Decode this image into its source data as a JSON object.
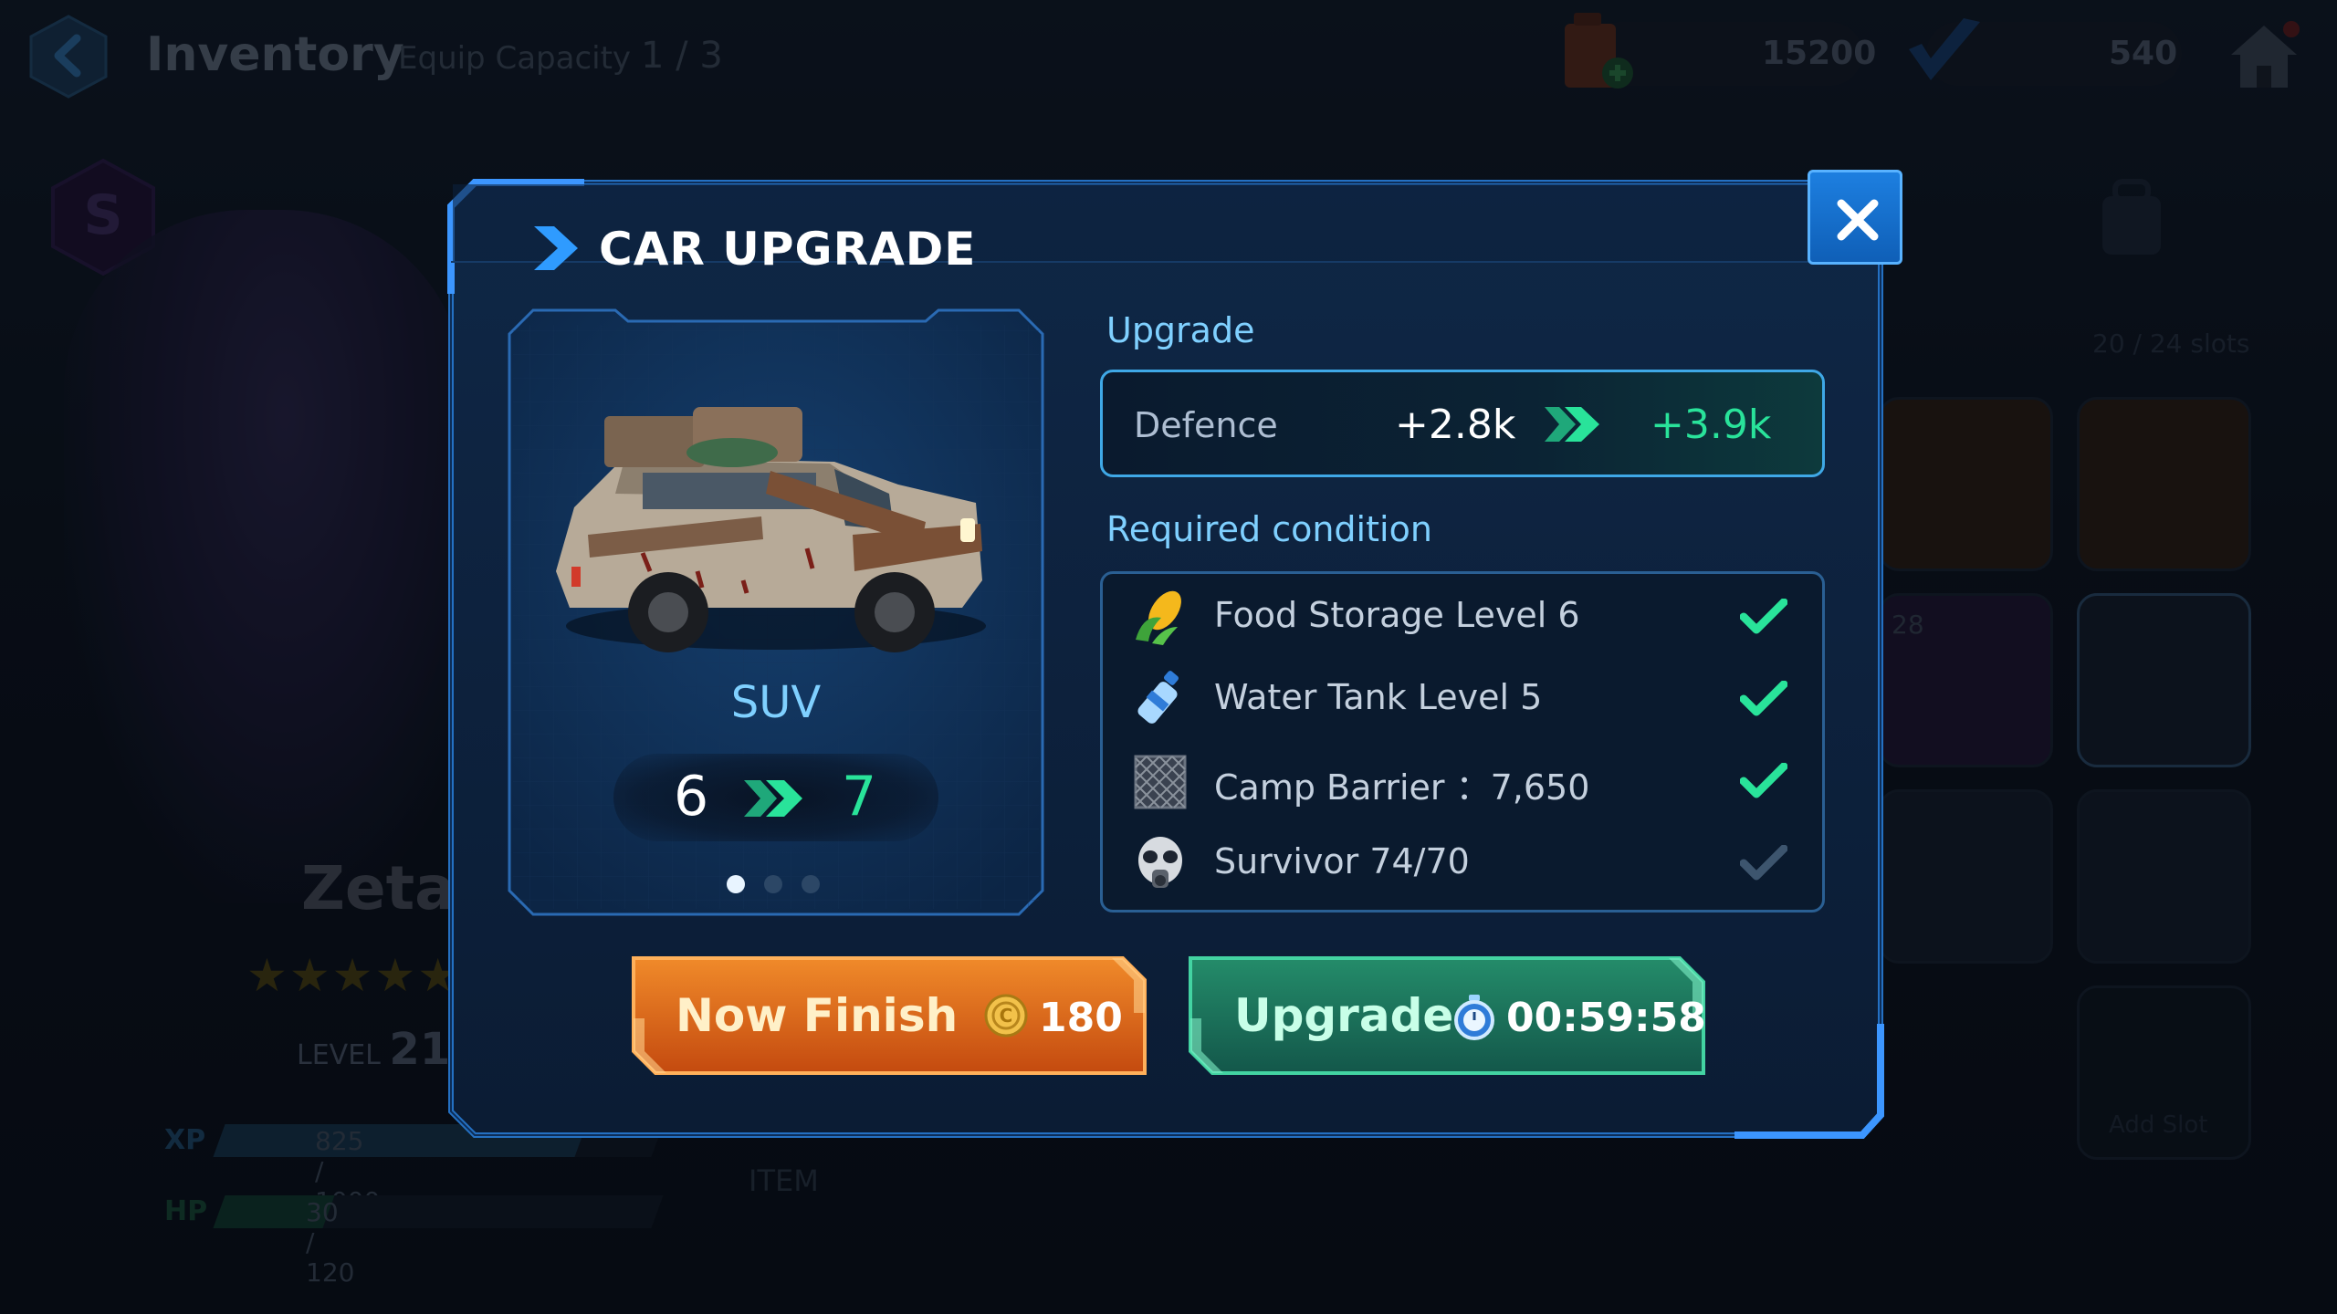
{
  "background": {
    "topbar": {
      "title": "Inventory",
      "capacity_label": "Equip Capacity",
      "capacity_value": "1 / 3",
      "fuel_amount": "15200",
      "shield_amount": "540"
    },
    "hero": {
      "rank_badge": "S",
      "name": "Zeta",
      "stars": "★★★★★",
      "level_label": "LEVEL",
      "level_value": "21",
      "xp_label": "XP",
      "xp_value": "825 / 1000",
      "xp_progress": 0.825,
      "hp_label": "HP",
      "hp_value": "30 / 120",
      "hp_progress": 0.25
    },
    "item_tab": "ITEM",
    "slots_label": "20 / 24 slots",
    "slot_count_badge": "28",
    "add_slot_label": "Add Slot"
  },
  "modal": {
    "title": "CAR UPGRADE",
    "car": {
      "name": "SUV",
      "level_from": "6",
      "level_to": "7",
      "page_count": 3,
      "page_active": 1
    },
    "upgrade_section": {
      "label": "Upgrade",
      "stat_label": "Defence",
      "stat_from": "+2.8k",
      "stat_to": "+3.9k"
    },
    "conditions_section": {
      "label": "Required condition",
      "items": [
        {
          "icon": "corn-icon",
          "text": "Food Storage Level 6",
          "met": true
        },
        {
          "icon": "water-bottle-icon",
          "text": "Water Tank Level 5",
          "met": true
        },
        {
          "icon": "fence-icon",
          "text": "Camp Barrier ：7,650",
          "met": true
        },
        {
          "icon": "gas-mask-icon",
          "text": "Survivor 74/70",
          "met": false
        }
      ]
    },
    "now_finish": {
      "label": "Now Finish",
      "cost": "180",
      "icon": "coin-icon"
    },
    "upgrade_button": {
      "label": "Upgrade",
      "timer": "00:59:58",
      "icon": "stopwatch-icon"
    }
  },
  "colors": {
    "accent_blue": "#7fd0ff",
    "accent_green": "#29e39a",
    "finish_orange": "#e8651a",
    "upgrade_green": "#1f7a5e",
    "close_blue": "#1d7fe0"
  }
}
